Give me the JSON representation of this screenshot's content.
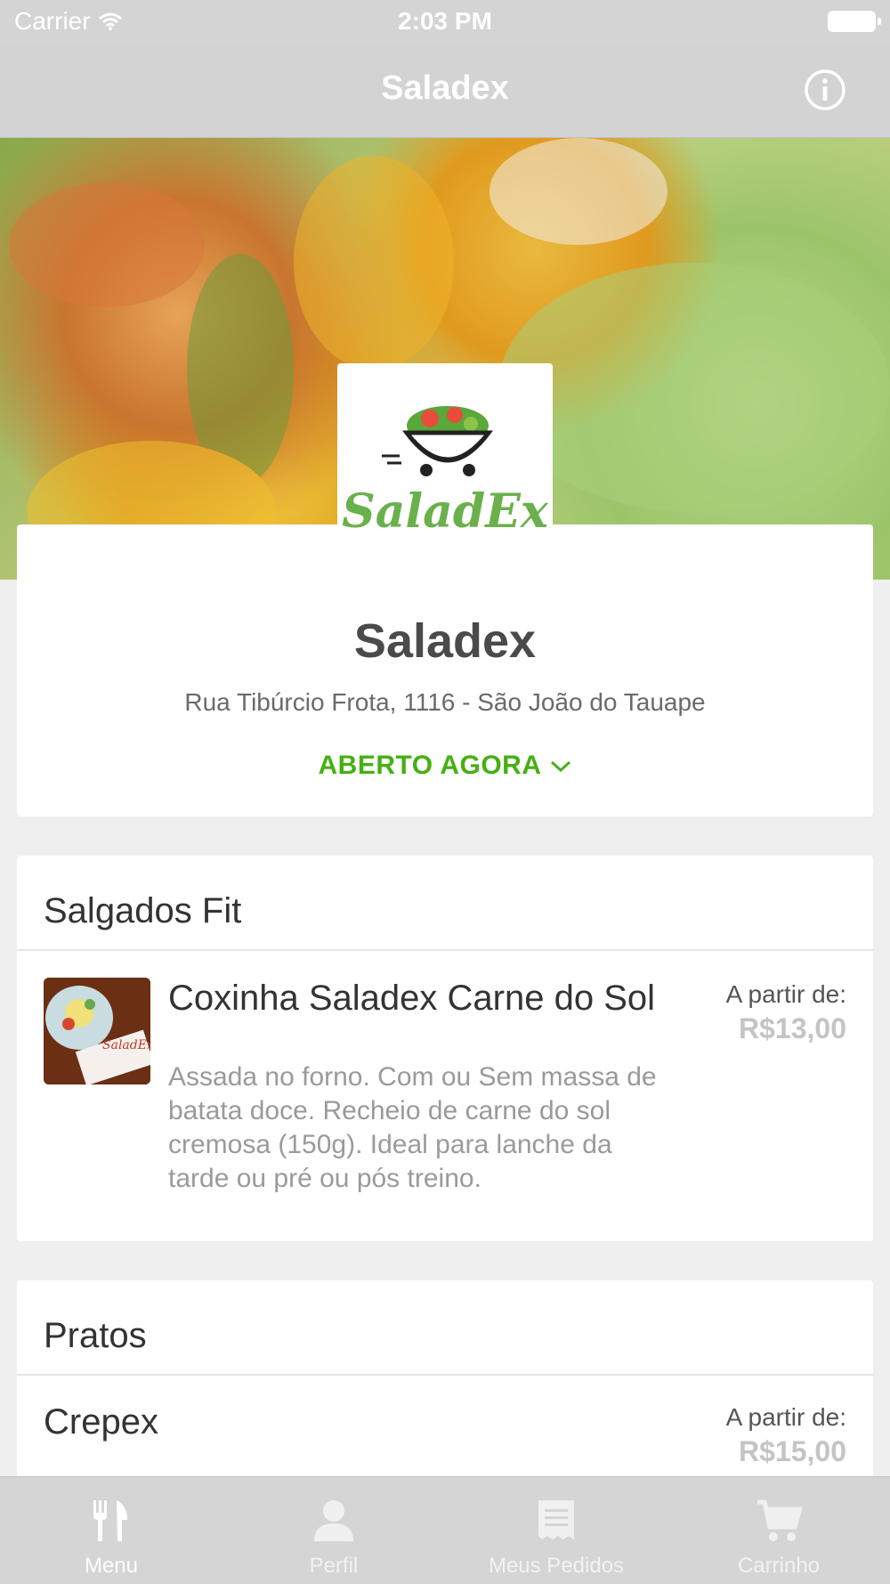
{
  "status_bar": {
    "carrier": "Carrier",
    "time": "2:03 PM"
  },
  "nav": {
    "title": "Saladex",
    "info_icon": "info-icon"
  },
  "logo": {
    "text": "SaladEx",
    "icon": "salad-cart-logo"
  },
  "restaurant": {
    "name": "Saladex",
    "address": "Rua Tibúrcio Frota, 1116 - São João do Tauape",
    "status": "ABERTO AGORA",
    "status_color": "#45b012"
  },
  "sections": [
    {
      "title": "Salgados Fit",
      "items": [
        {
          "name": "Coxinha Saladex Carne do Sol",
          "description": "Assada no forno. Com ou Sem massa de batata doce. Recheio de carne do sol cremosa (150g). Ideal para lanche da tarde ou pré ou pós treino.",
          "price_label": "A partir de:",
          "price": "R$13,00"
        }
      ]
    },
    {
      "title": "Pratos",
      "items": [
        {
          "name": "Crepex",
          "price_label": "A partir de:",
          "price": "R$15,00"
        }
      ]
    }
  ],
  "tabs": [
    {
      "label": "Menu",
      "icon": "fork-knife-icon",
      "active": true
    },
    {
      "label": "Perfil",
      "icon": "person-icon",
      "active": false
    },
    {
      "label": "Meus Pedidos",
      "icon": "receipt-icon",
      "active": false
    },
    {
      "label": "Carrinho",
      "icon": "cart-icon",
      "active": false
    }
  ]
}
